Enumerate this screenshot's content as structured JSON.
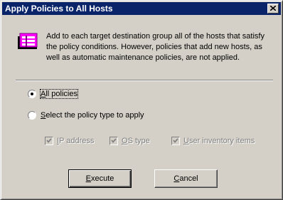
{
  "window": {
    "title": "Apply Policies to All Hosts"
  },
  "description": "Add to each target destination group all of the hosts that satisfy the policy conditions. However, policies that add new hosts, as well as automatic maintenance policies, are not applied.",
  "options": {
    "all_policies": {
      "accel": "A",
      "rest": "ll policies",
      "selected": true
    },
    "select_type": {
      "accel": "S",
      "rest": "elect the policy type to apply",
      "selected": false
    }
  },
  "policy_types": [
    {
      "accel": "I",
      "rest": "P address",
      "checked": true,
      "enabled": false
    },
    {
      "accel": "O",
      "rest": "S type",
      "checked": true,
      "enabled": false
    },
    {
      "accel": "U",
      "rest": "ser inventory items",
      "checked": true,
      "enabled": false
    }
  ],
  "buttons": {
    "execute": {
      "accel": "E",
      "rest": "xecute"
    },
    "cancel": {
      "accel": "C",
      "rest": "ancel"
    }
  }
}
